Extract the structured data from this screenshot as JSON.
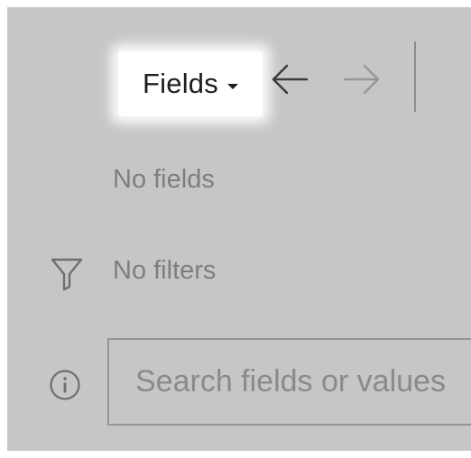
{
  "toolbar": {
    "fields_label": "Fields",
    "back_icon": "arrow-left-icon",
    "forward_icon": "arrow-right-icon"
  },
  "panel": {
    "fields_status": "No fields",
    "filters_status": "No filters",
    "filter_icon": "funnel-icon",
    "info_icon": "info-icon"
  },
  "search": {
    "placeholder": "Search fields or values",
    "value": ""
  },
  "colors": {
    "overlay": "#c6c6c6",
    "highlight": "#ffffff",
    "text_dark": "#1e1e1e",
    "text_muted": "#7e7e7e"
  }
}
